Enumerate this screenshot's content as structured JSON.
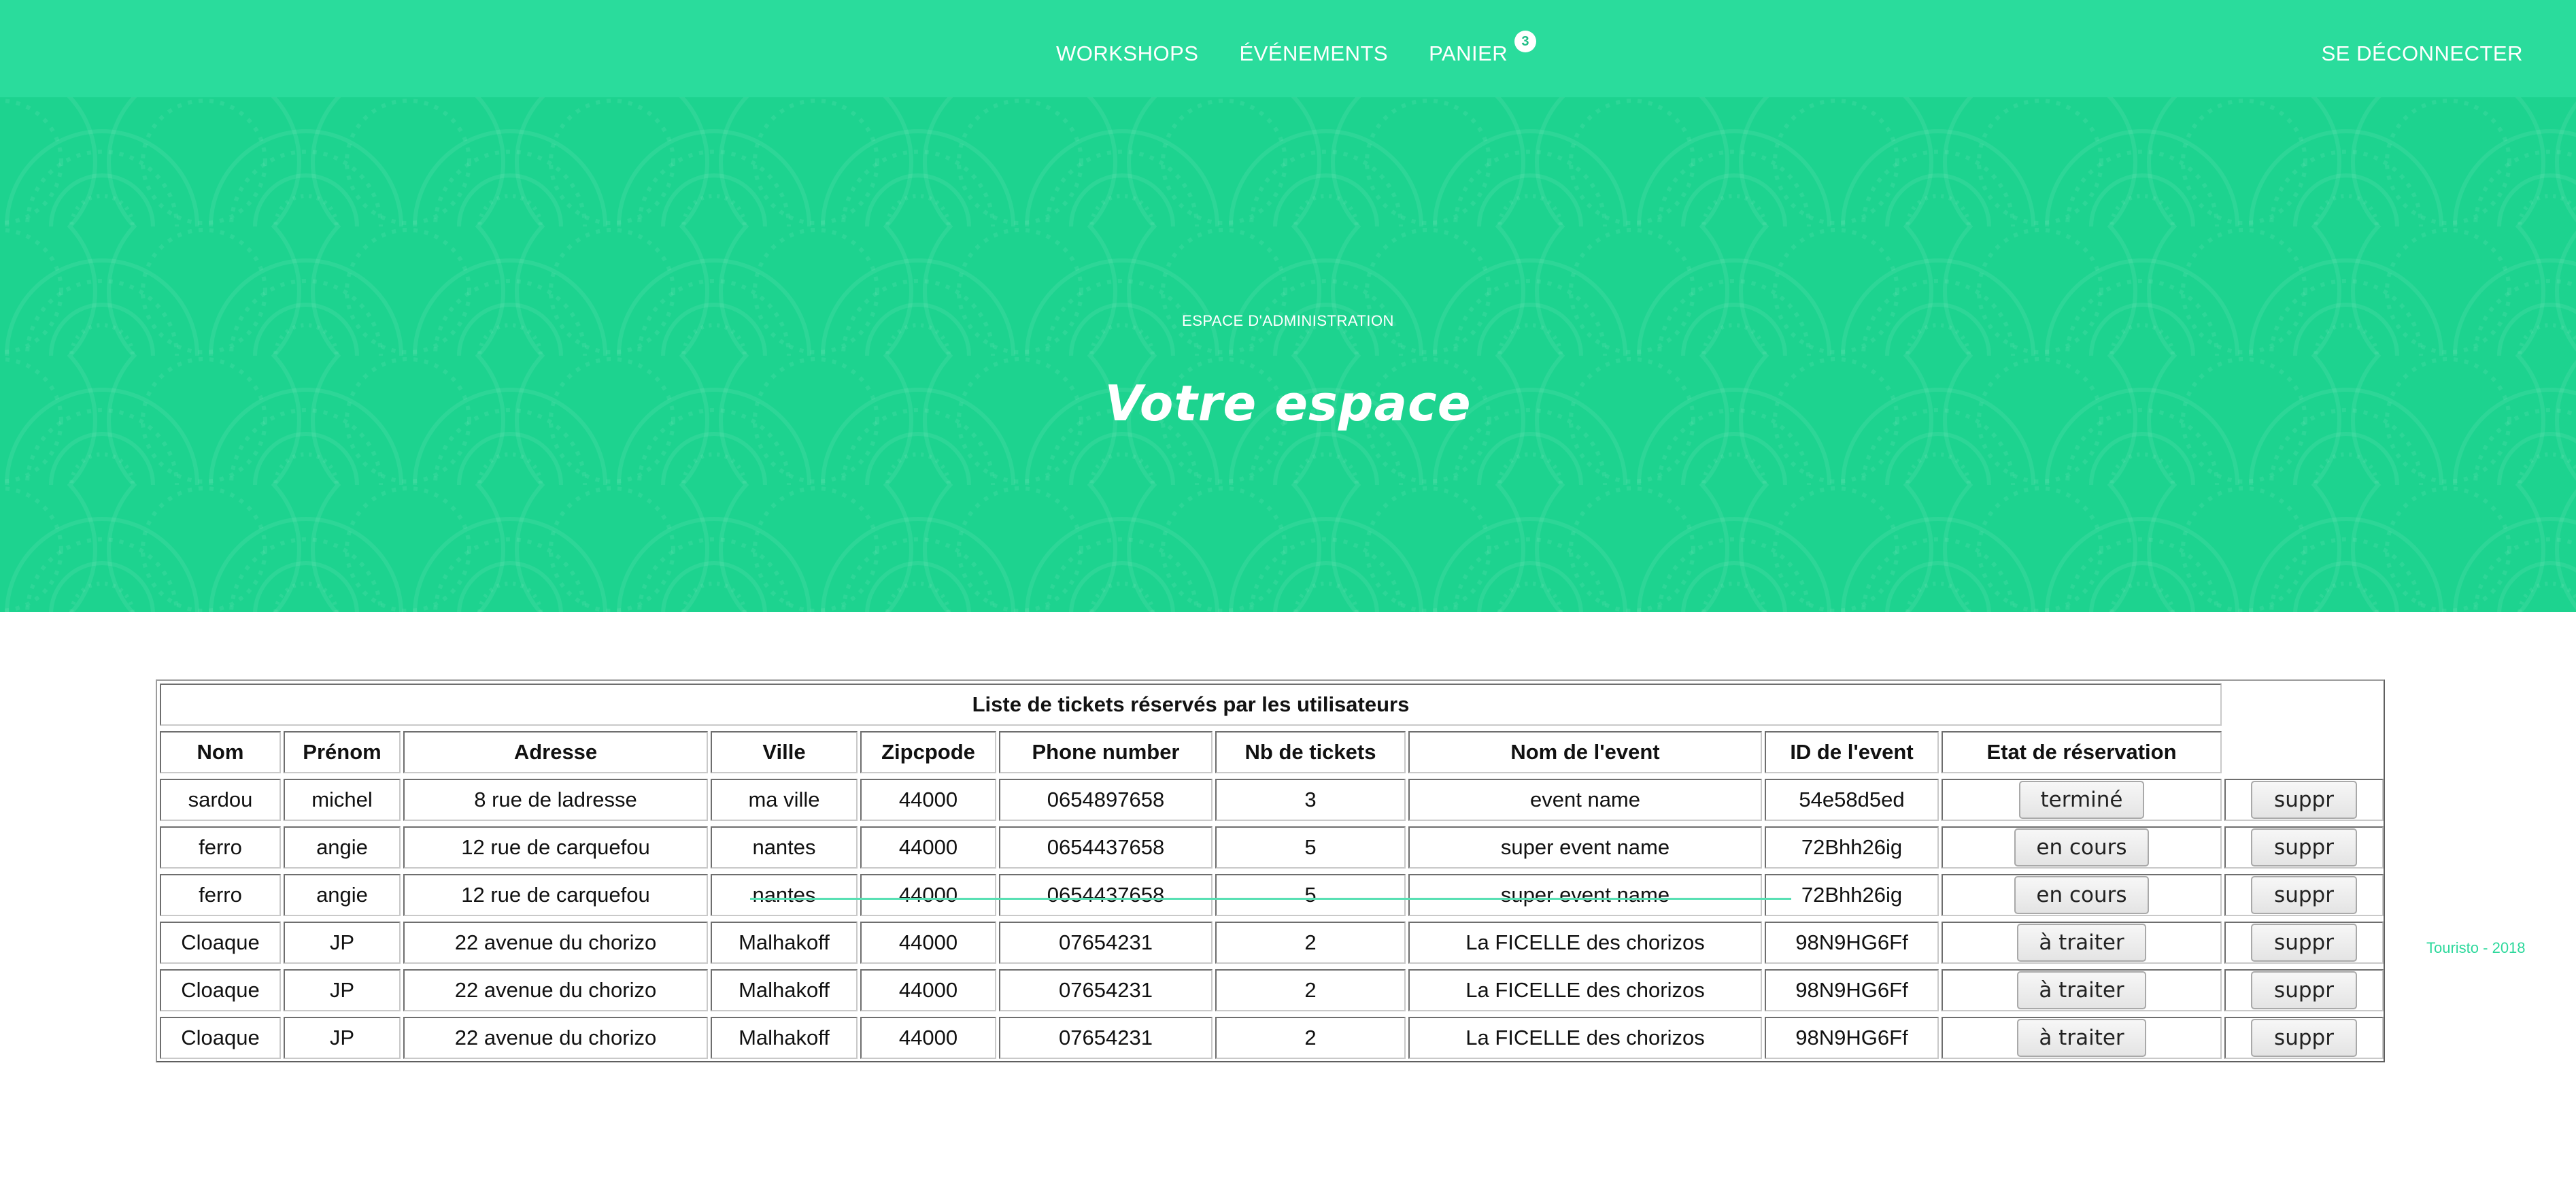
{
  "nav": {
    "links": [
      "WORKSHOPS",
      "ÉVÉNEMENTS",
      "PANIER"
    ],
    "cart_count": "3",
    "logout": "SE DÉCONNECTER"
  },
  "hero": {
    "kicker": "ESPACE D'ADMINISTRATION",
    "title": "Votre espace"
  },
  "table": {
    "caption": "Liste de tickets réservés par les utilisateurs",
    "headers": [
      "Nom",
      "Prénom",
      "Adresse",
      "Ville",
      "Zipcpode",
      "Phone number",
      "Nb de tickets",
      "Nom de l'event",
      "ID de l'event",
      "Etat de réservation"
    ],
    "rows": [
      [
        "sardou",
        "michel",
        "8 rue de ladresse",
        "ma ville",
        "44000",
        "0654897658",
        "3",
        "event name",
        "54e58d5ed",
        "terminé",
        "suppr"
      ],
      [
        "ferro",
        "angie",
        "12 rue de carquefou",
        "nantes",
        "44000",
        "0654437658",
        "5",
        "super event name",
        "72Bhh26ig",
        "en cours",
        "suppr"
      ],
      [
        "ferro",
        "angie",
        "12 rue de carquefou",
        "nantes",
        "44000",
        "0654437658",
        "5",
        "super event name",
        "72Bhh26ig",
        "en cours",
        "suppr"
      ],
      [
        "Cloaque",
        "JP",
        "22 avenue du chorizo",
        "Malhakoff",
        "44000",
        "07654231",
        "2",
        "La FICELLE des chorizos",
        "98N9HG6Ff",
        "à traiter",
        "suppr"
      ],
      [
        "Cloaque",
        "JP",
        "22 avenue du chorizo",
        "Malhakoff",
        "44000",
        "07654231",
        "2",
        "La FICELLE des chorizos",
        "98N9HG6Ff",
        "à traiter",
        "suppr"
      ],
      [
        "Cloaque",
        "JP",
        "22 avenue du chorizo",
        "Malhakoff",
        "44000",
        "07654231",
        "2",
        "La FICELLE des chorizos",
        "98N9HG6Ff",
        "à traiter",
        "suppr"
      ]
    ]
  },
  "footer": {
    "credit": "Touristo - 2018"
  },
  "colors": {
    "brand_green": "#2adc9c",
    "hero_green": "#1dd38f"
  }
}
